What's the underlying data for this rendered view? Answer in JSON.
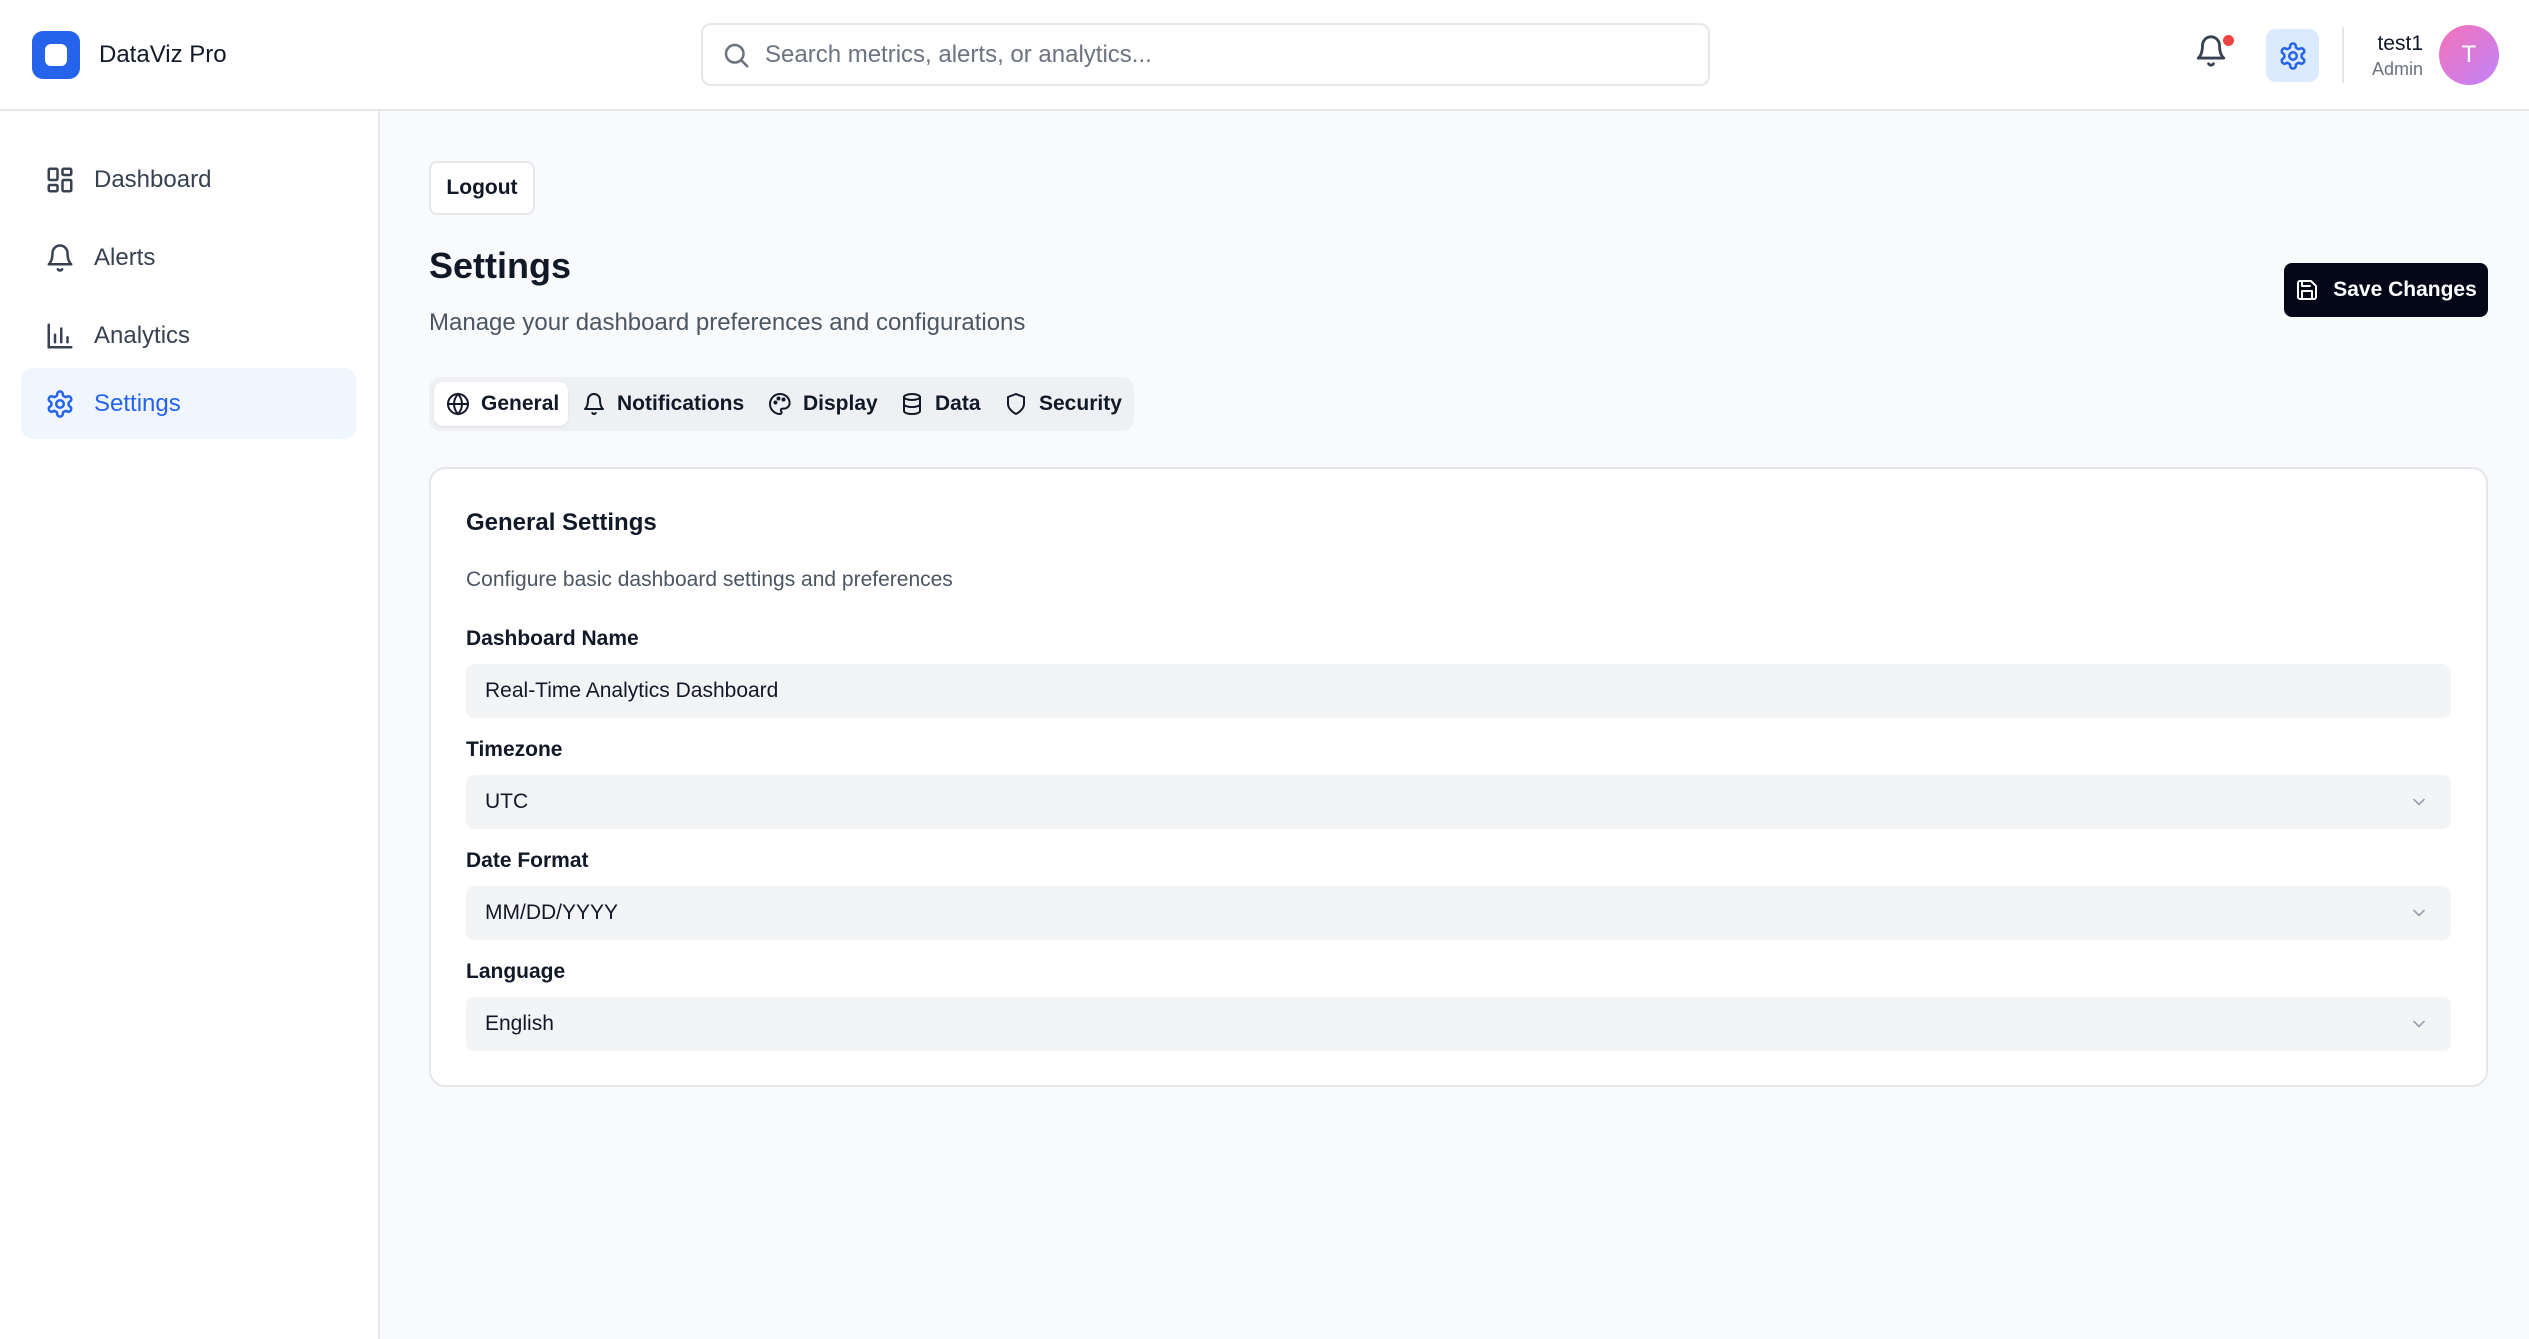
{
  "app": {
    "name": "DataViz Pro"
  },
  "search": {
    "placeholder": "Search metrics, alerts, or analytics..."
  },
  "user": {
    "name": "test1",
    "role": "Admin",
    "initial": "T"
  },
  "sidebar": {
    "items": [
      {
        "label": "Dashboard",
        "icon": "dashboard-grid-icon",
        "active": false
      },
      {
        "label": "Alerts",
        "icon": "bell-icon",
        "active": false
      },
      {
        "label": "Analytics",
        "icon": "bar-chart-icon",
        "active": false
      },
      {
        "label": "Settings",
        "icon": "gear-icon",
        "active": true
      }
    ]
  },
  "page": {
    "logout_label": "Logout",
    "title": "Settings",
    "subtitle": "Manage your dashboard preferences and configurations",
    "save_label": "Save Changes"
  },
  "tabs": [
    {
      "label": "General",
      "icon": "globe-icon",
      "active": true
    },
    {
      "label": "Notifications",
      "icon": "bell-icon",
      "active": false
    },
    {
      "label": "Display",
      "icon": "palette-icon",
      "active": false
    },
    {
      "label": "Data",
      "icon": "database-icon",
      "active": false
    },
    {
      "label": "Security",
      "icon": "shield-icon",
      "active": false
    }
  ],
  "general": {
    "title": "General Settings",
    "description": "Configure basic dashboard settings and preferences",
    "fields": [
      {
        "label": "Dashboard Name",
        "value": "Real-Time Analytics Dashboard",
        "type": "text"
      },
      {
        "label": "Timezone",
        "value": "UTC",
        "type": "select"
      },
      {
        "label": "Date Format",
        "value": "MM/DD/YYYY",
        "type": "select"
      },
      {
        "label": "Language",
        "value": "English",
        "type": "select"
      }
    ]
  },
  "colors": {
    "accent": "#2563eb",
    "active_nav_bg": "#eff6ff",
    "notification_dot": "#ef4444",
    "primary_button": "#020617"
  }
}
